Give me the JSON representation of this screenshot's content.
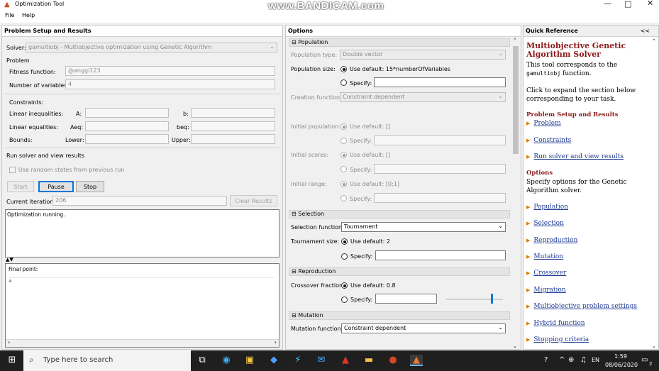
{
  "window": {
    "title": "Optimization Tool",
    "watermark": "www.BANDICAM.com",
    "minimize": "—",
    "maximize": "□",
    "close": "✕"
  },
  "menu": {
    "file": "File",
    "help": "Help"
  },
  "left": {
    "header": "Problem Setup and Results",
    "solver_label": "Solver:",
    "solver_value": "gamultiobj - Multiobjective optimization using Genetic Algorithm",
    "problem_label": "Problem",
    "fitness_label": "Fitness function:",
    "fitness_value": "@anggi123",
    "numvars_label": "Number of variables:",
    "numvars_value": "4",
    "constraints_label": "Constraints:",
    "lin_ineq_label": "Linear inequalities:",
    "A_label": "A:",
    "b_label": "b:",
    "lin_eq_label": "Linear equalities:",
    "Aeq_label": "Aeq:",
    "beq_label": "beq:",
    "bounds_label": "Bounds:",
    "lower_label": "Lower:",
    "upper_label": "Upper:",
    "run_label": "Run solver and view results",
    "random_states_label": "Use random states from previous run",
    "start_btn": "Start",
    "pause_btn": "Pause",
    "stop_btn": "Stop",
    "iteration_label": "Current iteration:",
    "iteration_value": "206",
    "clear_btn": "Clear Results",
    "status_text": "Optimization running.",
    "final_point_label": "Final point:"
  },
  "middle": {
    "header": "Options",
    "population": {
      "section": "⊟ Population",
      "type_label": "Population type:",
      "type_value": "Double vector",
      "size_label": "Population size:",
      "size_default": "Use default: 15*numberOfVariables",
      "specify": "Specify:",
      "creation_label": "Creation function:",
      "creation_value": "Constraint dependent",
      "initpop_label": "Initial population:",
      "initpop_default": "Use default: []",
      "initscores_label": "Initial scores:",
      "initscores_default": "Use default: []",
      "initrange_label": "Initial range:",
      "initrange_default": "Use default: [0;1]"
    },
    "selection": {
      "section": "⊟ Selection",
      "func_label": "Selection function:",
      "func_value": "Tournament",
      "size_label": "Tournament size:",
      "size_default": "Use default: 2",
      "specify": "Specify:"
    },
    "reproduction": {
      "section": "⊟ Reproduction",
      "crossover_label": "Crossover fraction:",
      "crossover_default": "Use default: 0.8",
      "specify": "Specify:"
    },
    "mutation": {
      "section": "⊟ Mutation",
      "func_label": "Mutation function:",
      "func_value": "Constraint dependent"
    }
  },
  "right": {
    "header": "Quick Reference",
    "collapse": "<<",
    "title": "Multiobjective Genetic Algorithm Solver",
    "intro_a": "This tool corresponds to the",
    "intro_code": "gamultiobj",
    "intro_b": "function.",
    "expand_text": "Click to expand the section below corresponding to your task.",
    "psr_heading": "Problem Setup and Results",
    "psr_links": [
      "Problem",
      "Constraints",
      "Run solver and view results"
    ],
    "options_heading": "Options",
    "options_text": "Specify options for the Genetic Algorithm solver.",
    "option_links": [
      "Population",
      "Selection",
      "Reproduction",
      "Mutation",
      "Crossover",
      "Migration",
      "Multiobjective problem settings",
      "Hybrid function",
      "Stopping criteria"
    ]
  },
  "taskbar": {
    "search_placeholder": "Type here to search",
    "time": "1:59",
    "date": "08/06/2020",
    "notification_count": "2"
  }
}
